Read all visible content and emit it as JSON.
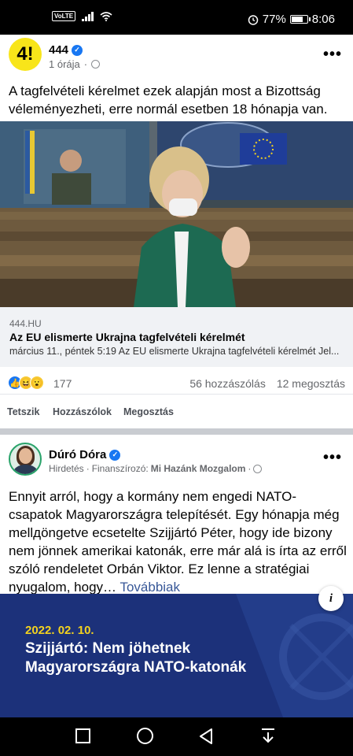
{
  "status_bar": {
    "network_label": "VoLTE",
    "battery": "77%",
    "battery_level": 0.77,
    "time": "8:06"
  },
  "post1": {
    "page_name": "444",
    "avatar_text": "4!",
    "time": "1 órája",
    "text": "A tagfelvételi kérelmet ezek alapján most a Bizottság véleményezheti, erre normál esetben 18 hónapja van.",
    "link": {
      "domain": "444.HU",
      "title": "Az EU elismerte Ukrajna tagfelvételi kérelmét",
      "description": "március 11., péntek 5:19 Az EU elismerte Ukrajna tagfelvételi kérelmét Jel..."
    },
    "reactions_count": "177",
    "comments": "56 hozzászólás",
    "shares": "12 megosztás",
    "actions": {
      "like": "Tetszik",
      "comment": "Hozzászólok",
      "share": "Megosztás"
    }
  },
  "post2": {
    "author": "Dúró Dóra",
    "ad_label": "Hirdetés",
    "sponsor_prefix": "Finanszírozó:",
    "sponsor": "Mi Hazánk Mozgalom",
    "text": "Ennyit arról, hogy a kormány nem engedi NATO-csapatok Magyarországra telepítését. Egy hónapja még mellдöngetve ecsetelte Szijjártó Péter, hogy ide bizony nem jönnek amerikai katonák, erre már alá is írta az erről szóló rendeletet Orbán Viktor. Ez lenne a stratégiai nyugalom, hogy…",
    "see_more": "Továbbiak",
    "image": {
      "date": "2022. 02. 10.",
      "headline_line1": "Szijjártó: Nem jöhetnek",
      "headline_line2": "Magyarországra NATO-katonák"
    }
  },
  "icons": [
    "wifi-icon",
    "signal-icon",
    "alarm-icon",
    "battery-icon",
    "verified-icon",
    "globe-icon",
    "more-icon",
    "like-icon",
    "haha-icon",
    "wow-icon",
    "info-icon",
    "square-nav-icon",
    "home-nav-icon",
    "back-nav-icon",
    "notification-nav-icon"
  ]
}
